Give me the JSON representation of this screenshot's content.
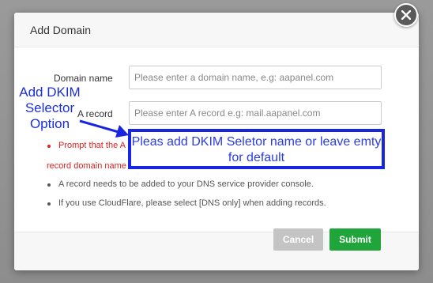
{
  "dialog": {
    "title": "Add Domain",
    "close_icon": "close-icon"
  },
  "form": {
    "domain_name_label": "Domain name",
    "domain_name_placeholder": "Please enter a domain name, e.g: aapanel.com",
    "a_record_label": "A record",
    "a_record_placeholder": "Please enter A record e.g: mail.aapanel.com"
  },
  "notes": [
    {
      "text": "Prompt that the A",
      "color": "red"
    },
    {
      "text": "record domain name",
      "color": "red"
    },
    {
      "text": "A record needs to be added to your DNS service provider console.",
      "color": "gray"
    },
    {
      "text": "If you use CloudFlare, please select [DNS only] when adding records.",
      "color": "gray"
    }
  ],
  "footer": {
    "cancel_label": "Cancel",
    "submit_label": "Submit"
  },
  "annotation": {
    "side_label": "Add DKIM Selector Option",
    "box_text": "Pleas add DKIM Seletor name or leave emty for default",
    "color": "#1826e0"
  },
  "colors": {
    "accent": "#20a53a",
    "warning": "#e02020",
    "cancel": "#c4c4c4"
  }
}
